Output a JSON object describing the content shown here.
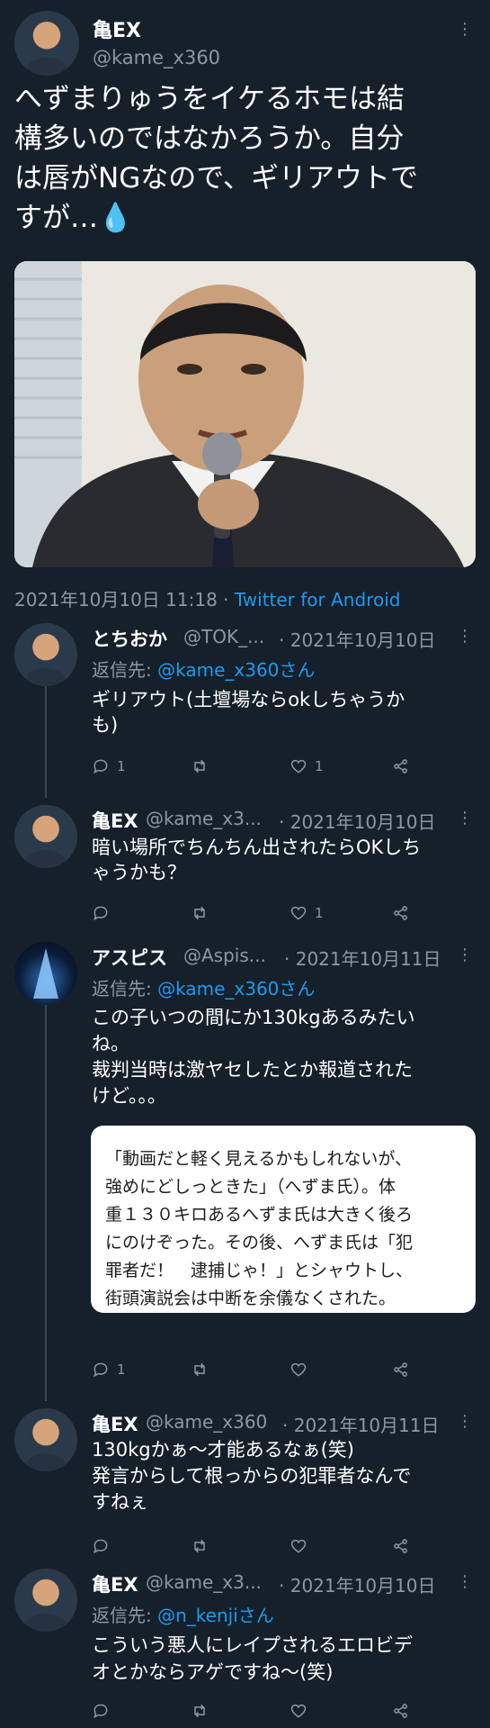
{
  "main_tweet": {
    "name": "亀EX",
    "handle": "@kame_x360",
    "text_lines": [
      "へずまりゅうをイケるホモは結",
      "構多いのではなかろうか。自分",
      "は唇がNGなので、ギリアウトで",
      "すが…💧"
    ],
    "timestamp": "2021年10月10日 11:18 · ",
    "client": "Twitter for Android",
    "image_icon": "press-photo-man-with-microphone"
  },
  "replies": [
    {
      "name": "とちおか",
      "handle": "@TOK_...",
      "date": "· 2021年10月10日",
      "reply_label": "返信先: ",
      "reply_to": "@kame_x360さん",
      "text_lines": [
        "ギリアウト(土壇場ならokしちゃうか",
        "も)"
      ],
      "reply_count": "1",
      "like_count": "1"
    },
    {
      "name": "亀EX",
      "handle": "@kame_x3...",
      "date": "· 2021年10月10日",
      "text_lines": [
        "暗い場所でちんちん出されたらOKしち",
        "ゃうかも？"
      ],
      "reply_count": "",
      "like_count": "1"
    },
    {
      "name": "アスピス",
      "handle": "@Aspis...",
      "date": "· 2021年10月11日",
      "reply_label": "返信先: ",
      "reply_to": "@kame_x360さん",
      "text_lines": [
        "この子いつの間にか130kgあるみたい",
        "ね。",
        "裁判当時は激ヤセしたとか報道された",
        "けど。。。"
      ],
      "quote_lines": [
        "「動画だと軽く見えるかもしれないが、",
        "強めにどしっときた」（へずま氏）。体",
        "重１３０キロあるへずま氏は大きく後ろ",
        "にのけぞった。その後、へずま氏は「犯",
        "罪者だ！　逮捕じゃ！」とシャウトし、",
        "街頭演説会は中断を余儀なくされた。"
      ],
      "reply_count": "1",
      "like_count": ""
    },
    {
      "name": "亀EX",
      "handle": "@kame_x360",
      "date": "· 2021年10月11日",
      "text_lines": [
        "130kgかぁ〜才能あるなぁ(笑)",
        "発言からして根っからの犯罪者なんで",
        "すねぇ"
      ],
      "reply_count": "",
      "like_count": ""
    },
    {
      "name": "亀EX",
      "handle": "@kame_x3...",
      "date": "· 2021年10月10日",
      "reply_label": "返信先: ",
      "reply_to": "@n_kenjiさん",
      "text_lines": [
        "こういう悪人にレイプされるエロビデ",
        "オとかならアゲですね〜(笑)"
      ],
      "reply_count": "",
      "like_count": ""
    }
  ],
  "colors": {
    "background": "#15202b",
    "accent": "#1d9bf0",
    "muted": "#8b98a5"
  }
}
